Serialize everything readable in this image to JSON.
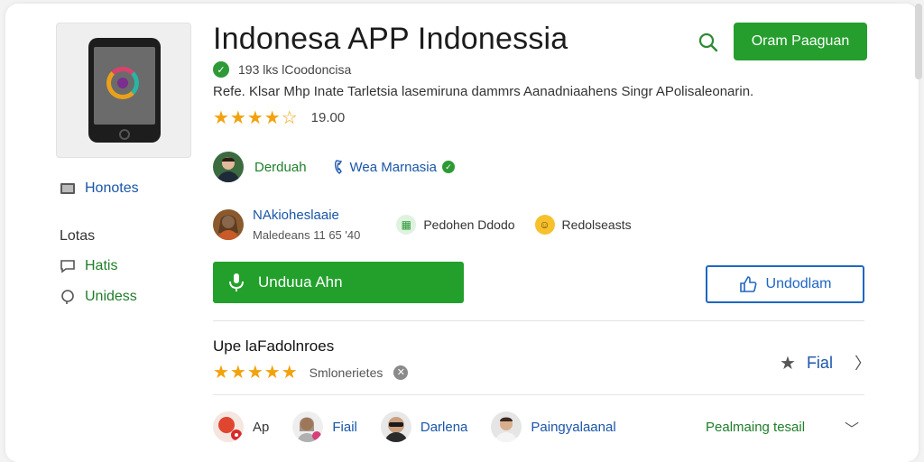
{
  "app": {
    "title": "Indonesa APP Indonessia",
    "meta": "193 lks lCoodoncisa",
    "description": "Refe. Klsar Mhp  Inate Tarletsia lasemiruna dammrs  Aanadniaahens Singr APolisaleonarin.",
    "rating_value": "19.00",
    "rating_stars": "★★★★☆",
    "top_cta": "Oram Paaguan"
  },
  "sidebar": {
    "link1": "Honotes",
    "section": "Lotas",
    "link2": "Hatis",
    "link3": "Unidess"
  },
  "developer": {
    "name": "Derduah",
    "verified_label": "Wea Marnasia"
  },
  "secondary": {
    "link": "NAkioheslaaie",
    "sub": "Maledeans 11 65 '40",
    "chip1": "Pedohen Ddodo",
    "chip2": "Redolseasts"
  },
  "actions": {
    "install": "Unduua Ahn",
    "secondary": "Undodlam"
  },
  "reviews": {
    "title": "Upe laFadolnroes",
    "stars": "★★★★★",
    "label": "Smlonerietes",
    "right_label": "Fial"
  },
  "people": [
    {
      "name": "Ap"
    },
    {
      "name": "Fiail"
    },
    {
      "name": "Darlena"
    },
    {
      "name": "Paingyalaanal"
    }
  ],
  "more_link": "Pealmaing tesail",
  "colors": {
    "brand_green": "#259e2e",
    "link_blue": "#1a56a8",
    "star_orange": "#f2a20c"
  }
}
